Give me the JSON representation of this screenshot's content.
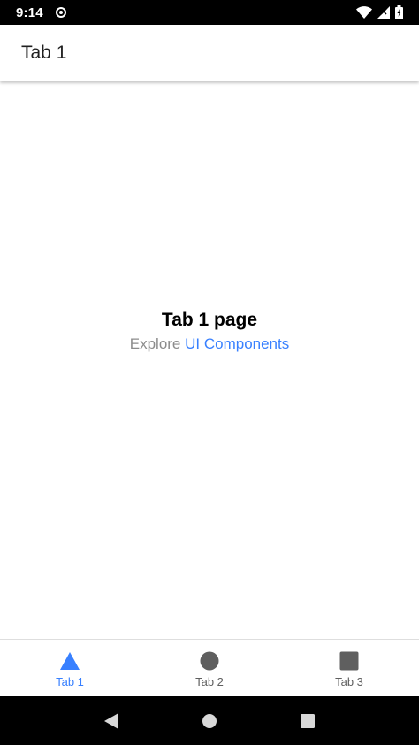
{
  "status_bar": {
    "time": "9:14",
    "icons": [
      "radio-dot-icon",
      "wifi-icon",
      "signal-icon",
      "battery-icon"
    ]
  },
  "header": {
    "title": "Tab 1"
  },
  "content": {
    "heading": "Tab 1 page",
    "explore_prefix": "Explore",
    "explore_link": "UI Components"
  },
  "tabs": [
    {
      "label": "Tab 1",
      "icon": "triangle-icon",
      "active": true
    },
    {
      "label": "Tab 2",
      "icon": "circle-icon",
      "active": false
    },
    {
      "label": "Tab 3",
      "icon": "square-icon",
      "active": false
    }
  ],
  "nav_bar": {
    "icons": [
      "back-icon",
      "home-icon",
      "recents-icon"
    ]
  },
  "colors": {
    "accent": "#3880ff",
    "inactive_tab": "#5f5f5f",
    "muted_text": "#8c8c8c"
  }
}
